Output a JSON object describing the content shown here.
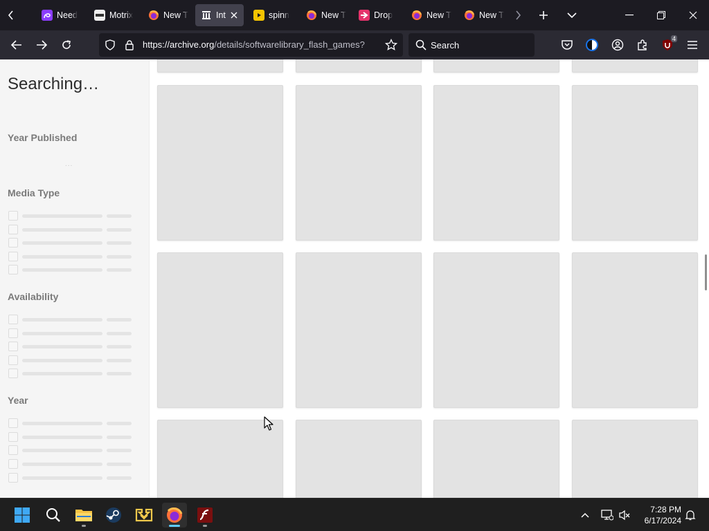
{
  "browser": {
    "tabs": [
      {
        "title": "Need",
        "favicon": "purple-swirl-icon",
        "color": "#8b3dff"
      },
      {
        "title": "Motrix",
        "favicon": "motrix-icon",
        "color": "#ffffff"
      },
      {
        "title": "New T",
        "favicon": "firefox-icon",
        "color": "#ff7139"
      },
      {
        "title": "Int",
        "favicon": "archive-icon",
        "color": "#ffffff",
        "active": true
      },
      {
        "title": "spinn",
        "favicon": "play-icon",
        "color": "#f5c400"
      },
      {
        "title": "New T",
        "favicon": "firefox-icon",
        "color": "#ff7139"
      },
      {
        "title": "Drop",
        "favicon": "dropmark-icon",
        "color": "#e5336b"
      },
      {
        "title": "New T",
        "favicon": "firefox-icon",
        "color": "#ff7139"
      },
      {
        "title": "New T",
        "favicon": "firefox-icon",
        "color": "#ff7139"
      }
    ],
    "url_host": "https://archive.org",
    "url_rest": "/details/softwarelibrary_flash_games?",
    "search_placeholder": "Search",
    "extension_badge": "4"
  },
  "sidebar": {
    "heading": "Searching…",
    "dots": "...",
    "facets": {
      "year_published": "Year Published",
      "media_type": "Media Type",
      "availability": "Availability",
      "year": "Year"
    }
  },
  "taskbar": {
    "time": "7:28 PM",
    "date": "6/17/2024"
  },
  "colors": {
    "tabstrip": "#1c1b22",
    "navbar": "#2b2a33",
    "skeleton": "#e3e3e3",
    "accent": "#60cdff"
  }
}
